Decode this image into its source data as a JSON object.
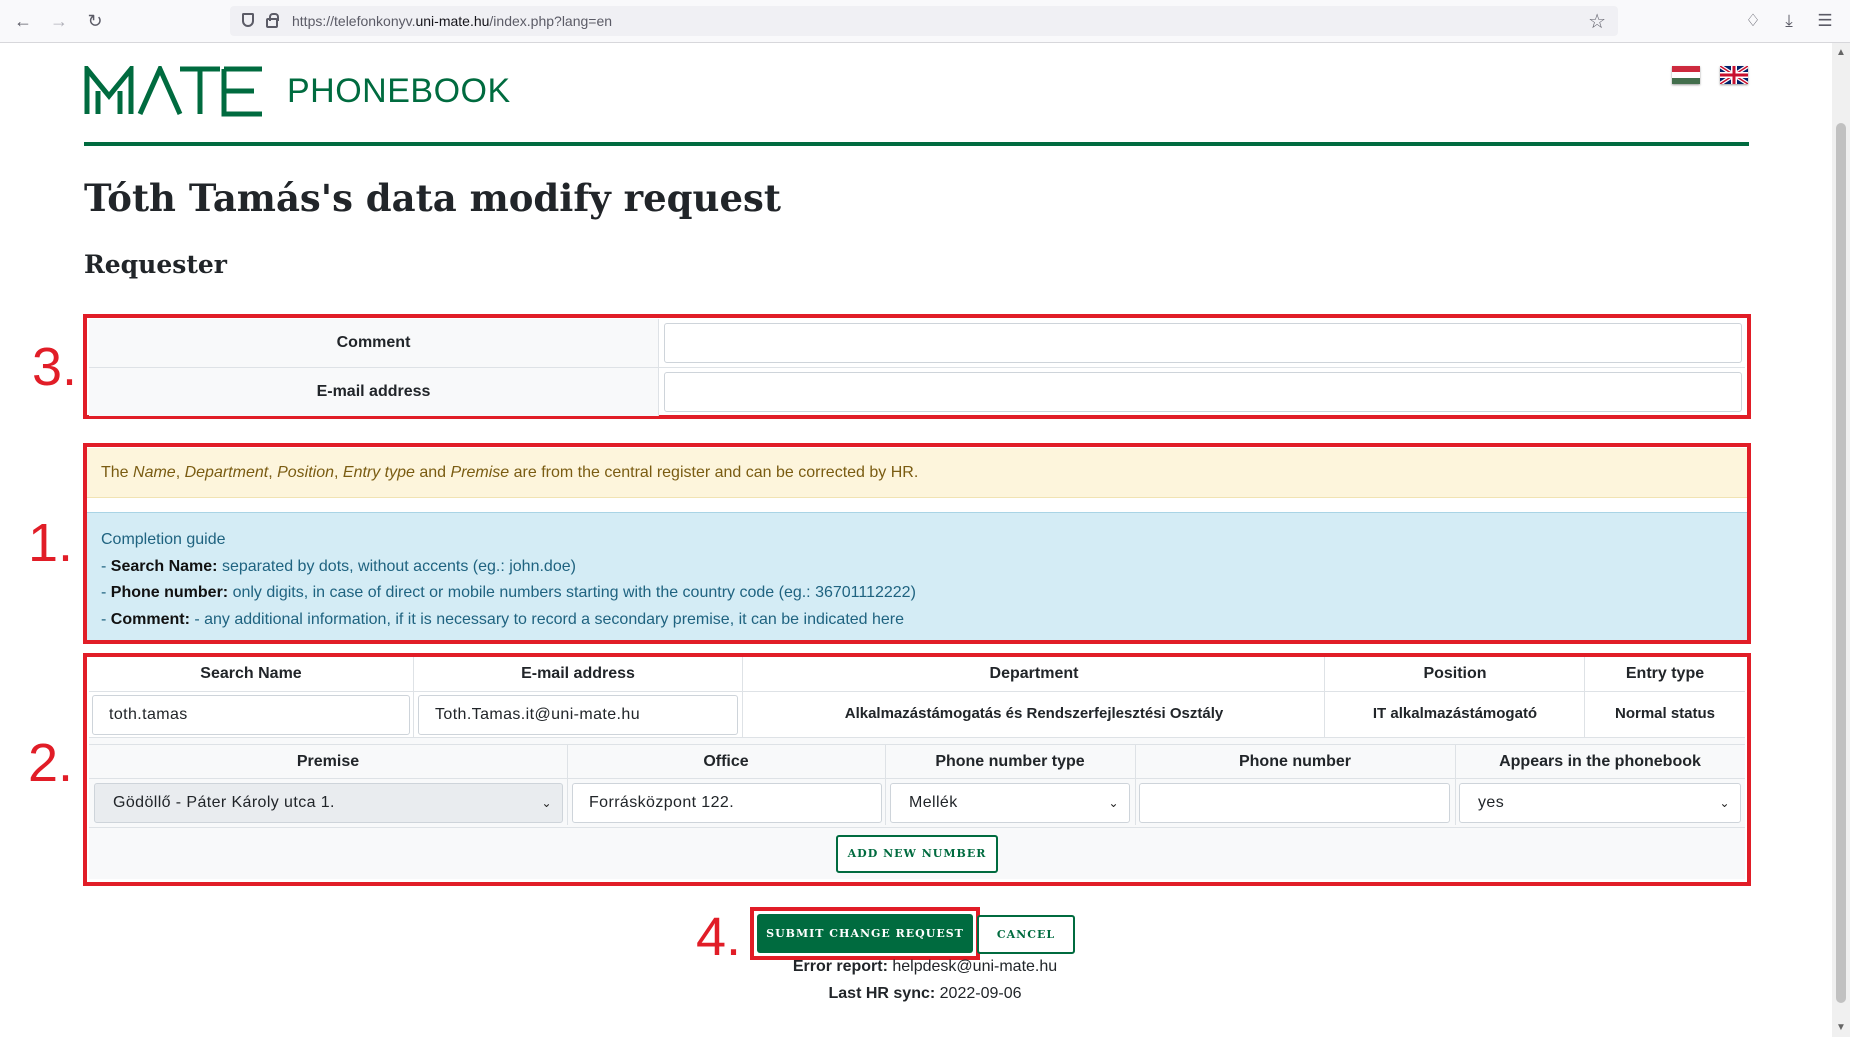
{
  "browser": {
    "url_prefix": "https://telefonkonyv.",
    "url_domain": "uni-mate.hu",
    "url_suffix": "/index.php?lang=en"
  },
  "header": {
    "brand": "PHONEBOOK",
    "logo_icon": "mate-logo-icon",
    "brand_color": "#006b3f"
  },
  "page": {
    "title": "Tóth Tamás's data modify request",
    "section": "Requester"
  },
  "annotations": [
    "3.",
    "1.",
    "2.",
    "4."
  ],
  "requester": {
    "comment_label": "Comment",
    "email_label": "E-mail address",
    "comment_value": "",
    "email_value": ""
  },
  "notice": {
    "t1": "The ",
    "i1": "Name",
    "t2": ", ",
    "i2": "Department",
    "t3": ", ",
    "i3": "Position",
    "t4": ", ",
    "i4": "Entry type",
    "t5": " and ",
    "i5": "Premise",
    "t6": " are from the central register and can be corrected by HR."
  },
  "guide": {
    "title": "Completion guide",
    "items": [
      {
        "prefix": "- ",
        "label": "Search Name:",
        "text": " separated by dots, without accents (eg.: john.doe)"
      },
      {
        "prefix": "- ",
        "label": "Phone number:",
        "text": " only digits, in case of direct or mobile numbers starting with the country code (eg.: 36701112222)"
      },
      {
        "prefix": "- ",
        "label": "Comment:",
        "text": " - any additional information, if it is necessary to record a secondary premise, it can be indicated here"
      }
    ]
  },
  "person": {
    "headers": {
      "search_name": "Search Name",
      "email": "E-mail address",
      "department": "Department",
      "position": "Position",
      "entry_type": "Entry type"
    },
    "search_name": "toth.tamas",
    "email": "Toth.Tamas.it@uni-mate.hu",
    "department": "Alkalmazástámogatás és Rendszerfejlesztési Osztály",
    "position": "IT alkalmazástámogató",
    "entry_type": "Normal status"
  },
  "phone": {
    "headers": {
      "premise": "Premise",
      "office": "Office",
      "phone_type": "Phone number type",
      "phone_number": "Phone number",
      "appears": "Appears in the phonebook"
    },
    "premise": "Gödöllő - Páter Károly utca 1.",
    "office": "Forrásközpont 122.",
    "phone_type": "Mellék",
    "phone_number": "",
    "appears": "yes",
    "add_button": "ADD NEW NUMBER"
  },
  "actions": {
    "submit": "SUBMIT CHANGE REQUEST",
    "cancel": "CANCEL"
  },
  "footer": {
    "error_label": "Error report:",
    "error_value": " helpdesk@uni-mate.hu",
    "sync_label": "Last HR sync:",
    "sync_value": " 2022-09-06"
  }
}
